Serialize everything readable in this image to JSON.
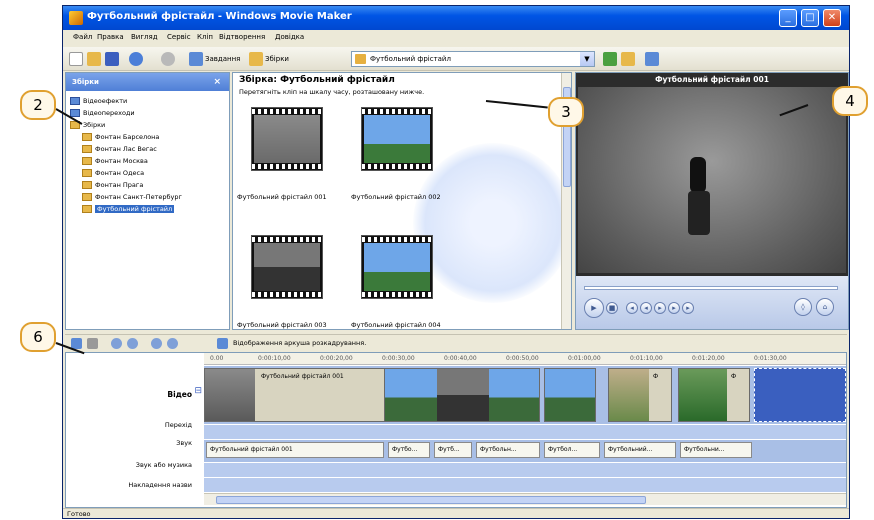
{
  "window": {
    "title": "Футбольний фрістайл - Windows Movie Maker",
    "buttons": {
      "minimize": "_",
      "maximize": "□",
      "close": "✕"
    }
  },
  "menu": [
    "Файл",
    "Правка",
    "Вигляд",
    "Сервіс",
    "Кліп",
    "Відтворення",
    "Довідка"
  ],
  "toolbar": {
    "tasks_label": "Завдання",
    "collections_label": "Збірки",
    "collection_combo": "Футбольний фрістайл"
  },
  "collections_pane": {
    "header": "Збірки",
    "close": "×",
    "items": [
      "Відеоефекти",
      "Відеопереходи",
      "Збірки",
      "Фонтан Барселона",
      "Фонтан Лас Вегас",
      "Фонтан Москва",
      "Фонтан Одеса",
      "Фонтан Прага",
      "Фонтан Санкт-Петербург",
      "Футбольний фрістайл"
    ]
  },
  "collection": {
    "title": "Збірка: Футбольний фрістайл",
    "subtitle": "Перетягніть кліп на шкалу часу, розташовану нижче.",
    "clips": [
      "Футбольний фрістайл 001",
      "Футбольний фрістайл 002",
      "Футбольний фрістайл 003",
      "Футбольний фрістайл 004"
    ]
  },
  "monitor": {
    "title": "Футбольний фрістайл 001",
    "seek_position": 0.0
  },
  "timeline": {
    "toolbar_text": "Відображення аркуша розкадрування.",
    "ruler": [
      "0.00",
      "0:00:10,00",
      "0:00:20,00",
      "0:00:30,00",
      "0:00:40,00",
      "0:00:50,00",
      "0:01:00,00",
      "0:01:10,00",
      "0:01:20,00",
      "0:01:30,00"
    ],
    "labels": {
      "video": "Відео",
      "expand": "⊟",
      "transition": "Перехід",
      "audio": "Звук",
      "audio_music": "Звук або музика",
      "title_overlay": "Накладення назви"
    },
    "video_clip_label": "Футбольний фрістайл 001",
    "video_clip_marks": [
      "Ф",
      "Ф"
    ],
    "audio_clips": [
      "Футбольний фрістайл 001",
      "Футбо...",
      "Футб...",
      "Футбольн...",
      "Футбол...",
      "Футбольний...",
      "Футбольни..."
    ]
  },
  "status": "Готово",
  "callouts": [
    "2",
    "3",
    "4",
    "6"
  ]
}
